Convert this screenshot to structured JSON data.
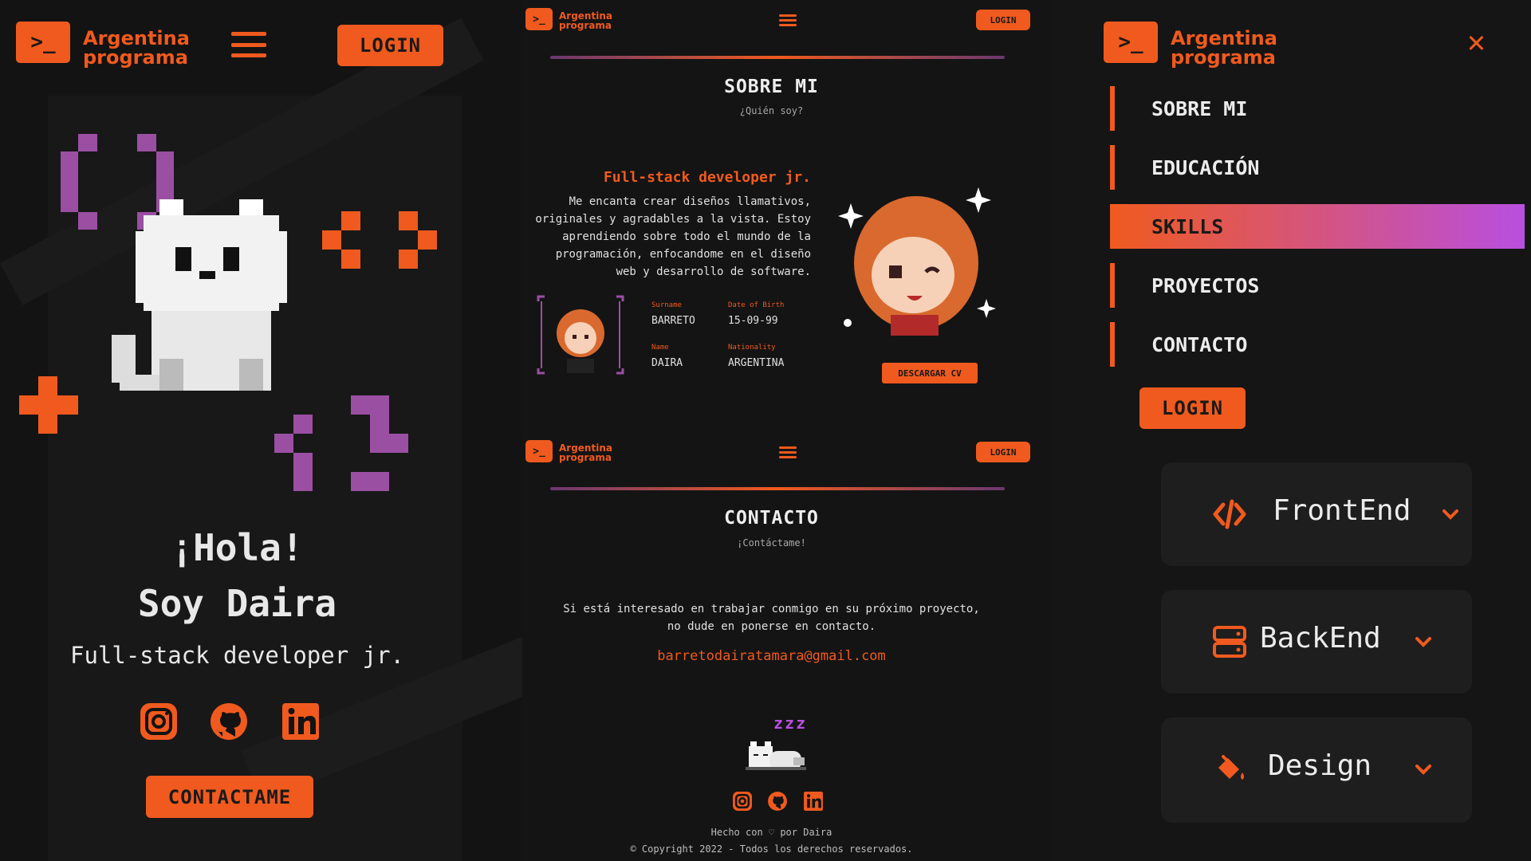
{
  "brand": {
    "logo_glyph": ">_",
    "line1": "Argentina",
    "line2": "programa",
    "color": "#f05a1e"
  },
  "colors": {
    "accent": "#f05a1e",
    "purple": "#9a4fa3",
    "gradient_end": "#b94fe0",
    "background": "#141414"
  },
  "left": {
    "login": "LOGIN",
    "greeting": "¡Hola!",
    "name": "Soy Daira",
    "role": "Full-stack developer jr.",
    "contact_button": "CONTACTAME",
    "socials": [
      "instagram-icon",
      "github-icon",
      "linkedin-icon"
    ]
  },
  "about": {
    "login": "LOGIN",
    "title": "SOBRE MI",
    "subtitle": "¿Quién soy?",
    "heading": "Full-stack developer jr.",
    "bio_lines": [
      "Me encanta crear diseños llamativos,",
      "originales y agradables a la vista. Estoy",
      "aprendiendo sobre todo el mundo de la",
      "programación, enfocandome en el diseño",
      "web y desarrollo de software."
    ],
    "fields": {
      "surname_label": "Surname",
      "surname": "BARRETO",
      "dob_label": "Date of Birth",
      "dob": "15-09-99",
      "name_label": "Name",
      "name": "DAIRA",
      "nationality_label": "Nationality",
      "nationality": "ARGENTINA"
    },
    "cv_button": "DESCARGAR CV"
  },
  "contact": {
    "login": "LOGIN",
    "title": "CONTACTO",
    "subtitle": "¡Contáctame!",
    "text_line1": "Si está interesado en trabajar conmigo en su próximo proyecto,",
    "text_line2": "no dude en ponerse en contacto.",
    "email": "barretodairatamara@gmail.com",
    "sleep_text": "zzz",
    "footer_made": "Hecho con ♡ por Daira",
    "footer_copy": "© Copyright 2022 - Todos los derechos reservados."
  },
  "menu": {
    "close_glyph": "✕",
    "items": [
      {
        "label": "SOBRE MI"
      },
      {
        "label": "EDUCACIÓN"
      },
      {
        "label": "SKILLS"
      },
      {
        "label": "PROYECTOS"
      },
      {
        "label": "CONTACTO"
      }
    ],
    "active": "SKILLS",
    "login": "LOGIN"
  },
  "skills": [
    {
      "label": "FrontEnd",
      "icon": "code-icon"
    },
    {
      "label": "BackEnd",
      "icon": "server-icon"
    },
    {
      "label": "Design",
      "icon": "paint-bucket-icon"
    }
  ]
}
